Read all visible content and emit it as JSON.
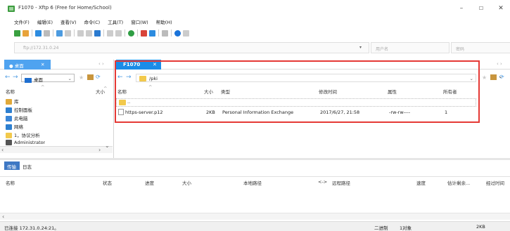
{
  "window": {
    "title": "F1070 - Xftp 6 (Free for Home/School)",
    "min_label": "–",
    "max_label": "☐",
    "close_label": "✕"
  },
  "menu": [
    "文件(F)",
    "编辑(E)",
    "查看(V)",
    "命令(C)",
    "工具(T)",
    "窗口(W)",
    "帮助(H)"
  ],
  "toolbar_icons": [
    "new-session-icon",
    "open-icon",
    "transfer-icon",
    "sync-icon",
    "refresh-icon",
    "split-icon",
    "layout-icon",
    "info-icon",
    "help-icon",
    "chat-icon"
  ],
  "address": {
    "host_placeholder": "ftp://172.31.0.24",
    "user_placeholder": "用户名",
    "password_placeholder": "密码"
  },
  "local": {
    "tab_label": "桌面",
    "path": "桌面",
    "col_name": "名称",
    "col_size": "大小",
    "tree": [
      {
        "label": "库",
        "icon": "library-icon",
        "color": "#e0a93a"
      },
      {
        "label": "控制面板",
        "icon": "control-panel-icon",
        "color": "#2d7fd0"
      },
      {
        "label": "此电脑",
        "icon": "computer-icon",
        "color": "#3a86d8"
      },
      {
        "label": "网络",
        "icon": "network-icon",
        "color": "#2d7fd0"
      },
      {
        "label": "1，协议分析",
        "icon": "folder-icon",
        "color": "#f2c94c"
      },
      {
        "label": "Administrator",
        "icon": "user-icon",
        "color": "#555"
      }
    ]
  },
  "remote": {
    "tab_label": "F1070",
    "path": "/pki",
    "columns": {
      "name": "名称",
      "size": "大小",
      "type": "类型",
      "modified": "修改时间",
      "attributes": "属性",
      "owner": "所有者"
    },
    "rows": [
      {
        "name": "..",
        "size": "",
        "type": "",
        "modified": "",
        "attributes": "",
        "owner": ""
      },
      {
        "name": "https-server.p12",
        "size": "2KB",
        "type": "Personal Information Exchange",
        "modified": "2017/6/27, 21:58",
        "attributes": "-rw-rw----",
        "owner": "1"
      }
    ]
  },
  "transfer": {
    "tab_transfers": "传输",
    "tab_log": "日志",
    "columns": {
      "name": "名称",
      "status": "状态",
      "progress": "进度",
      "size": "大小",
      "local_path": "本地路径",
      "direction": "<->",
      "remote_path": "远程路径",
      "speed": "速度",
      "remaining": "估计剩余...",
      "elapsed": "经过时间"
    }
  },
  "status": {
    "connection": "已连接 172.31.0.24:21。",
    "mode": "二进制",
    "objects": "1对象",
    "size": "2KB"
  },
  "colors": {
    "accent": "#1a8ce8",
    "highlight_box": "#e53935"
  }
}
